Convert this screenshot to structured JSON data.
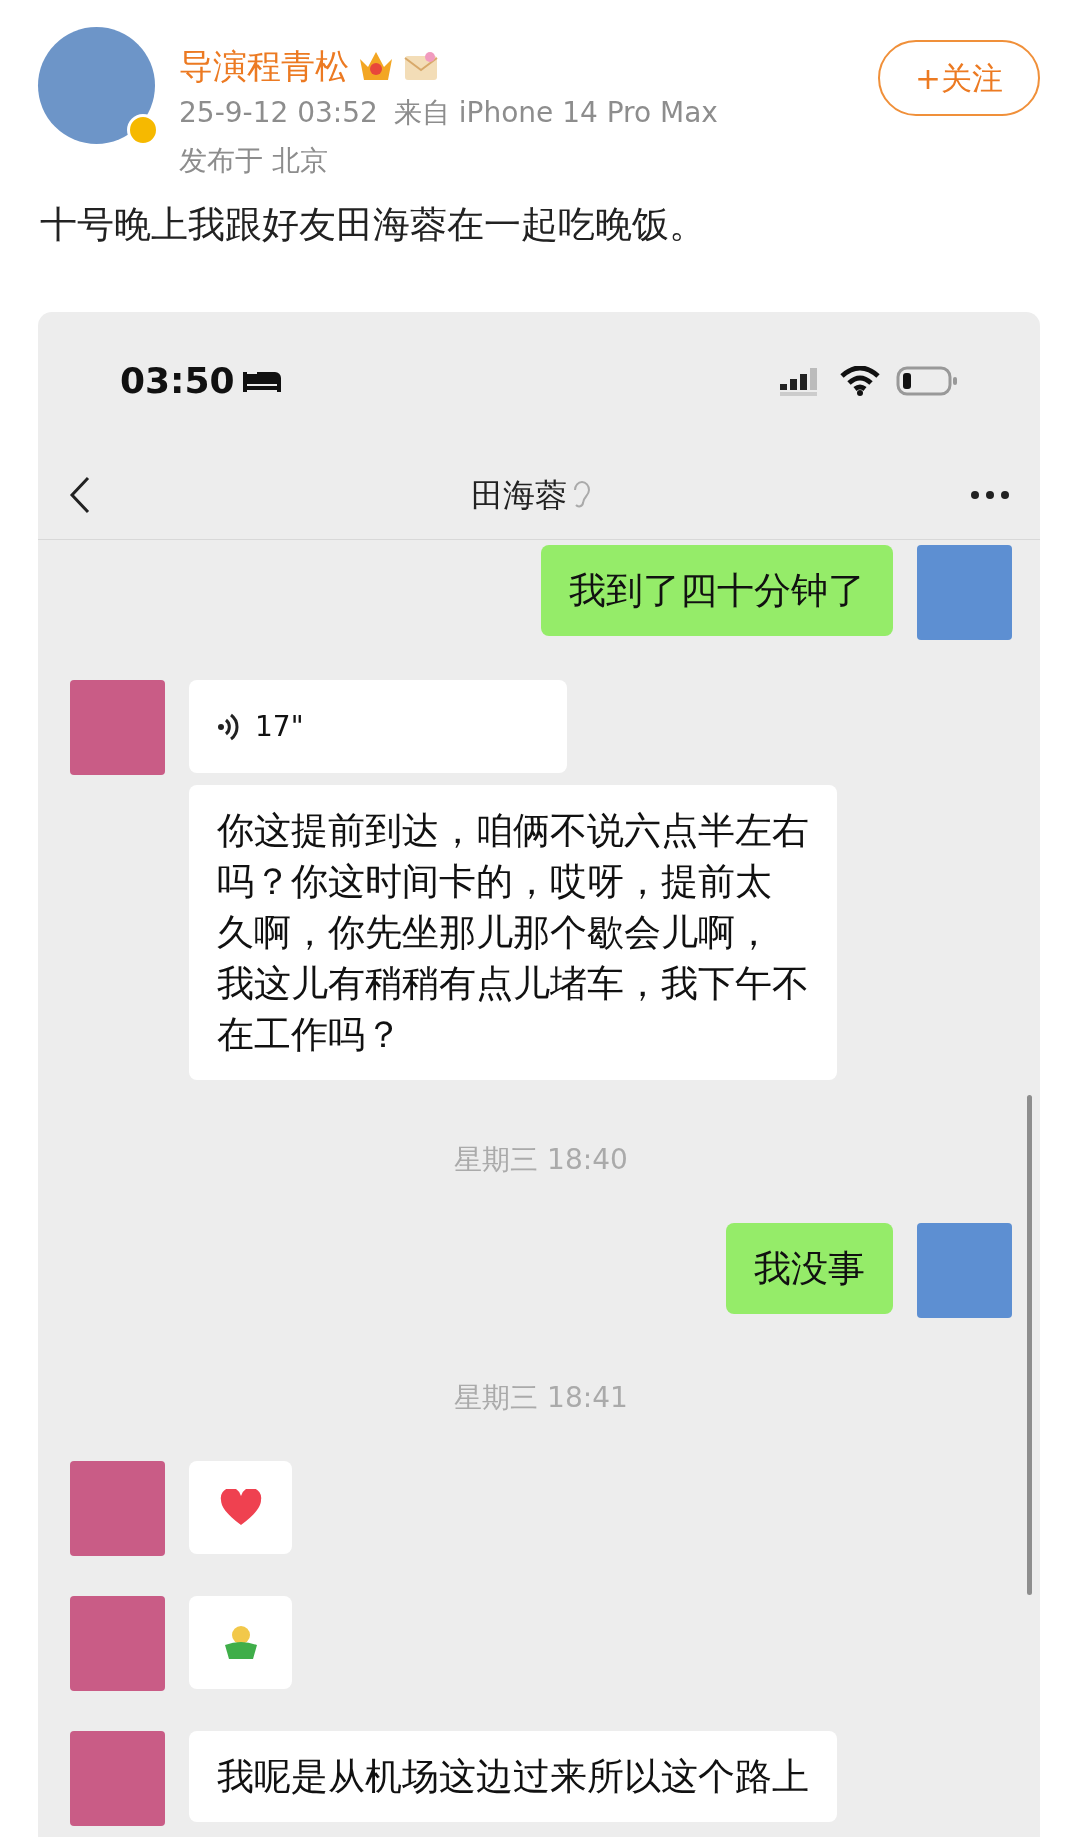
{
  "post": {
    "author": "导演程青松",
    "time": "25-9-12 03:52",
    "source": "来自 iPhone 14 Pro Max",
    "location": "发布于 北京",
    "follow_button": "+关注",
    "text": "十号晚上我跟好友田海蓉在一起吃晚饭。"
  },
  "screenshot": {
    "status_bar": {
      "time": "03:50"
    },
    "chat_title": "田海蓉",
    "messages": [
      {
        "kind": "text",
        "outgoing": true,
        "avatar": true,
        "lines": [
          "我到了四十分钟了"
        ]
      },
      {
        "kind": "voice",
        "outgoing": false,
        "avatar": true,
        "duration": "17\""
      },
      {
        "kind": "text",
        "outgoing": false,
        "avatar": false,
        "lines": [
          "你这提前到达，咱俩不说六点半左右",
          "吗？你这时间卡的，哎呀，提前太",
          "久啊，你先坐那儿那个歇会儿啊，",
          "我这儿有稍稍有点儿堵车，我下午不",
          "在工作吗？"
        ]
      },
      {
        "kind": "time",
        "text": "星期三 18:40"
      },
      {
        "kind": "text",
        "outgoing": true,
        "avatar": true,
        "lines": [
          "我没事"
        ]
      },
      {
        "kind": "time",
        "text": "星期三 18:41"
      },
      {
        "kind": "heart",
        "outgoing": false,
        "avatar": true
      },
      {
        "kind": "figure",
        "outgoing": false,
        "avatar": true
      },
      {
        "kind": "text",
        "outgoing": false,
        "avatar": true,
        "lines": [
          "我呢是从机场这边过来所以这个路上"
        ]
      }
    ]
  }
}
